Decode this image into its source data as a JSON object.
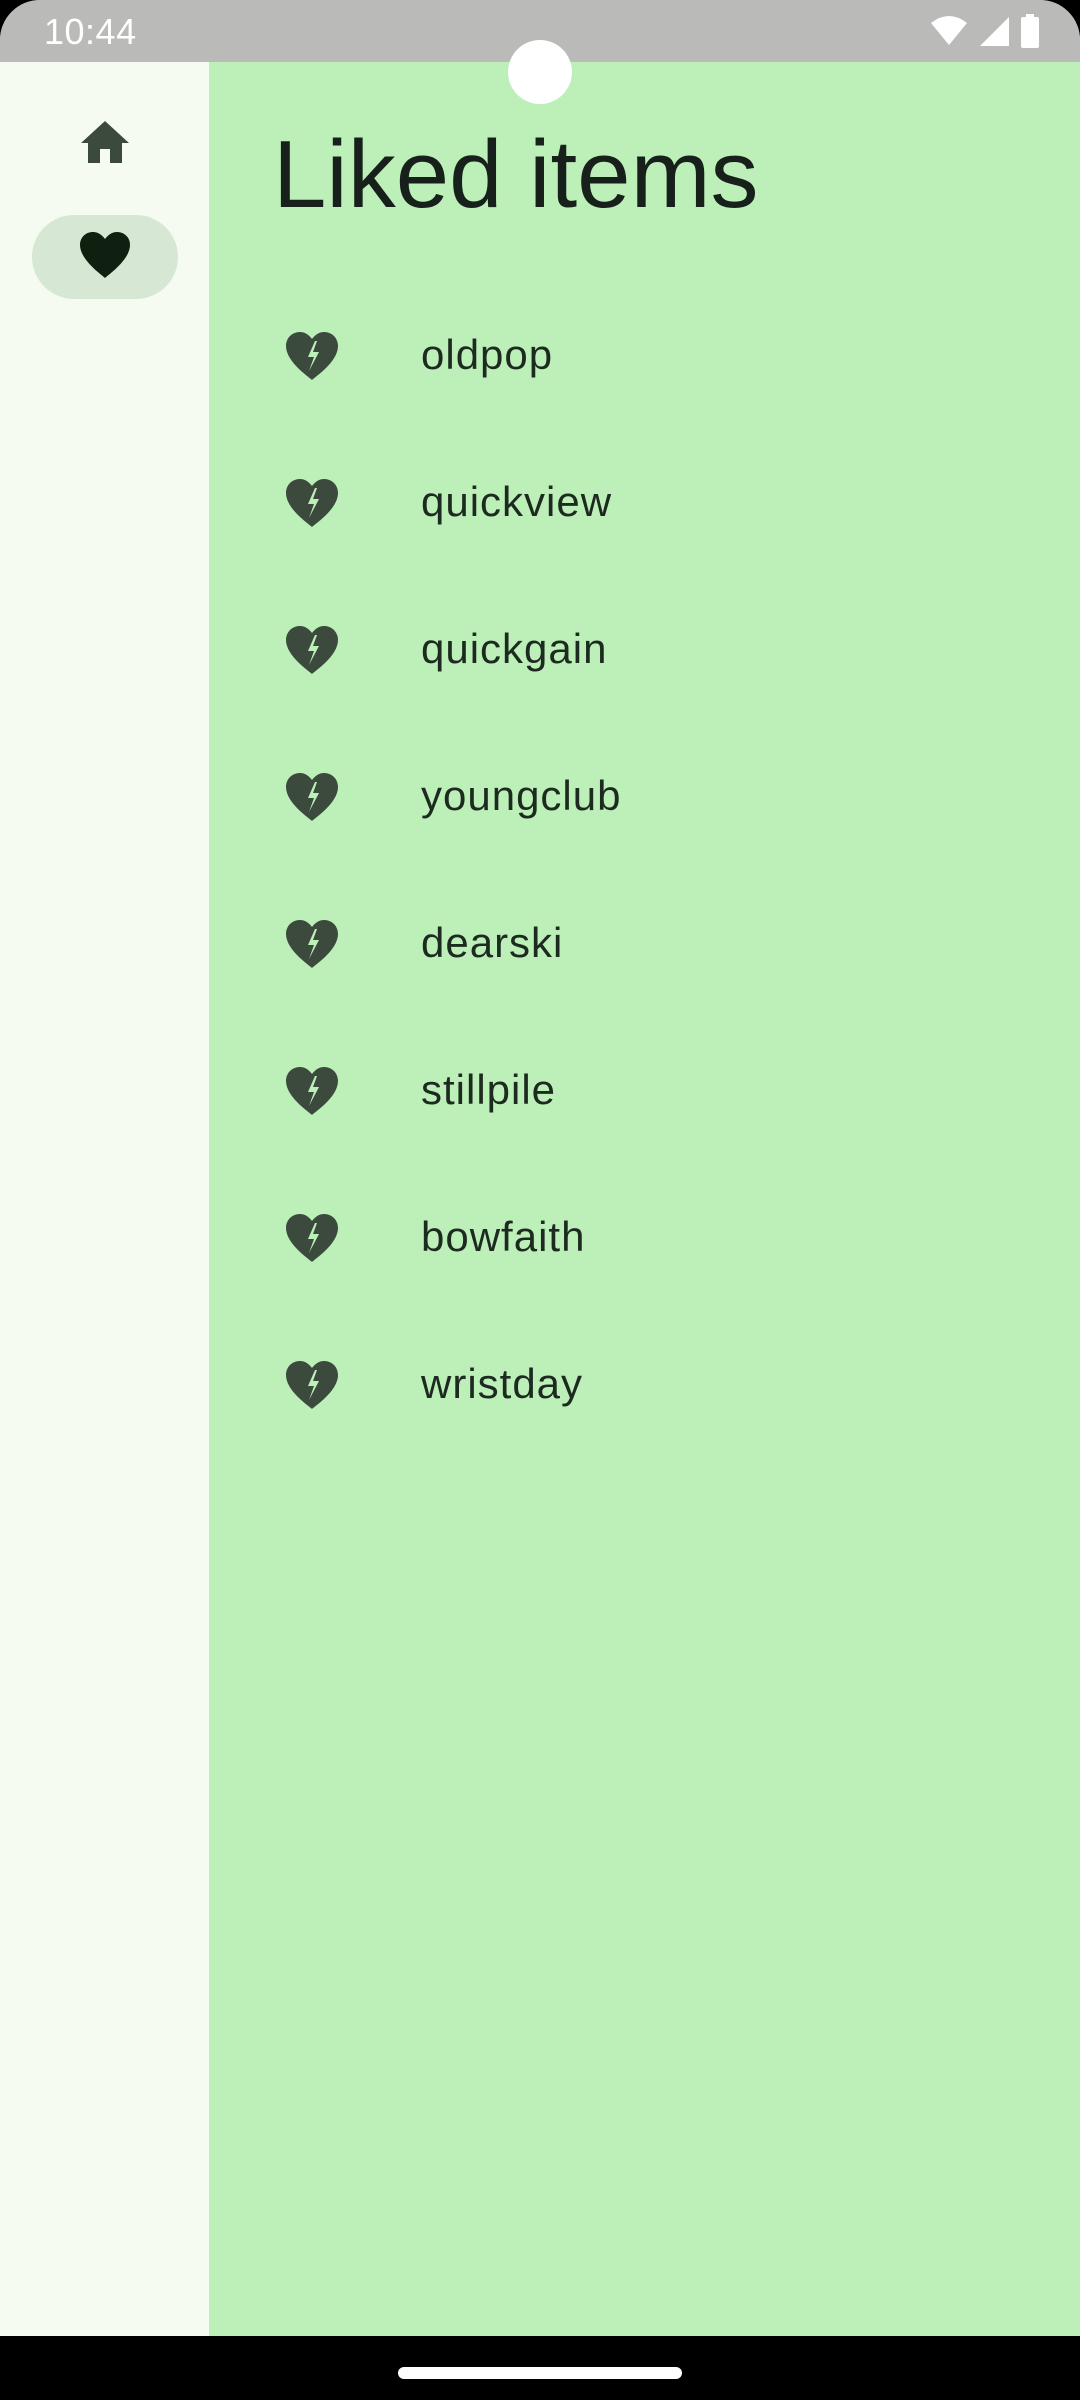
{
  "status_bar": {
    "time": "10:44",
    "icons": [
      "wifi-icon",
      "cellular-signal-icon",
      "battery-icon"
    ]
  },
  "nav_rail": {
    "items": [
      {
        "icon": "home-icon",
        "selected": false
      },
      {
        "icon": "heart-icon",
        "selected": true
      }
    ]
  },
  "page": {
    "title": "Liked items"
  },
  "liked_items": [
    {
      "label": "oldpop",
      "icon": "broken-heart-icon"
    },
    {
      "label": "quickview",
      "icon": "broken-heart-icon"
    },
    {
      "label": "quickgain",
      "icon": "broken-heart-icon"
    },
    {
      "label": "youngclub",
      "icon": "broken-heart-icon"
    },
    {
      "label": "dearski",
      "icon": "broken-heart-icon"
    },
    {
      "label": "stillpile",
      "icon": "broken-heart-icon"
    },
    {
      "label": "bowfaith",
      "icon": "broken-heart-icon"
    },
    {
      "label": "wristday",
      "icon": "broken-heart-icon"
    }
  ],
  "colors": {
    "content_background": "#bdf0b9",
    "rail_background": "#f6fbf2",
    "rail_selected_indicator": "#d6e8d3",
    "icon": "#3c4a3e",
    "text": "#1d2a20",
    "status_bar": "#babbb8"
  }
}
